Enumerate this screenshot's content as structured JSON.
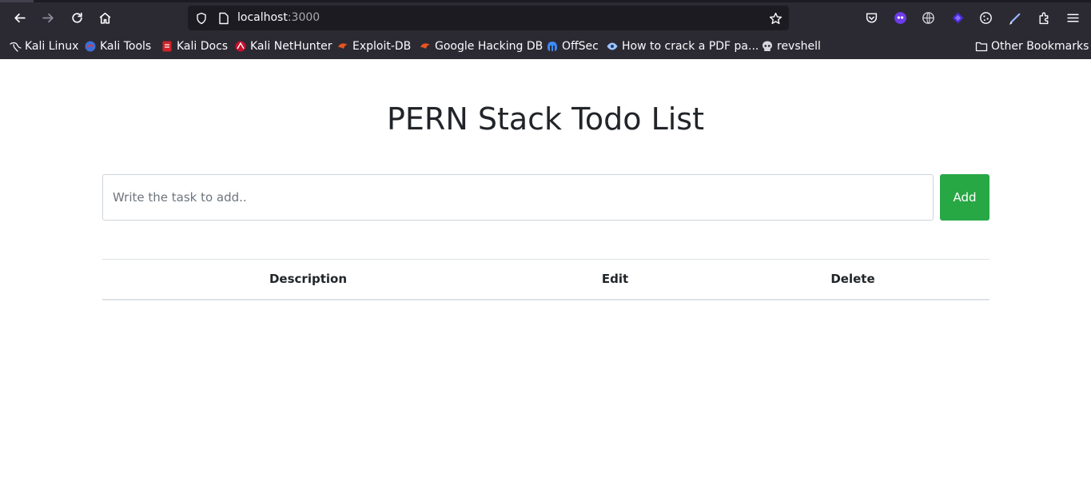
{
  "browser": {
    "url_host": "localhost",
    "url_port": ":3000",
    "icons": {
      "back": "arrow-left-icon",
      "forward": "arrow-right-icon",
      "reload": "reload-icon",
      "home": "home-icon",
      "shield": "shield-icon",
      "page": "page-icon",
      "bookmark_star": "star-icon"
    },
    "extensions": [
      "pocket-icon",
      "extension-icon",
      "globe-icon",
      "extension-icon",
      "cookie-icon",
      "pen-icon",
      "puzzle-icon",
      "menu-icon"
    ],
    "bookmarks": [
      {
        "label": "Kali Linux",
        "icon": "kali-dragon-icon"
      },
      {
        "label": "Kali Tools",
        "icon": "kali-tools-icon"
      },
      {
        "label": "Kali Docs",
        "icon": "kali-docs-icon"
      },
      {
        "label": "Kali NetHunter",
        "icon": "nethunter-icon"
      },
      {
        "label": "Exploit-DB",
        "icon": "exploit-db-icon"
      },
      {
        "label": "Google Hacking DB",
        "icon": "ghdb-icon"
      },
      {
        "label": "OffSec",
        "icon": "offsec-icon"
      },
      {
        "label": "How to crack a PDF pa...",
        "icon": "eye-icon"
      },
      {
        "label": "revshell",
        "icon": "skull-icon"
      }
    ],
    "other_bookmarks": {
      "label": "Other Bookmarks",
      "icon": "folder-icon"
    }
  },
  "app": {
    "title": "PERN Stack Todo List",
    "input_placeholder": "Write the task to add..",
    "input_value": "",
    "add_label": "Add",
    "columns": [
      "Description",
      "Edit",
      "Delete"
    ],
    "rows": []
  },
  "colors": {
    "add_button": "#28a745",
    "browser_chrome": "#2b2a33",
    "url_bar": "#1c1b22"
  }
}
